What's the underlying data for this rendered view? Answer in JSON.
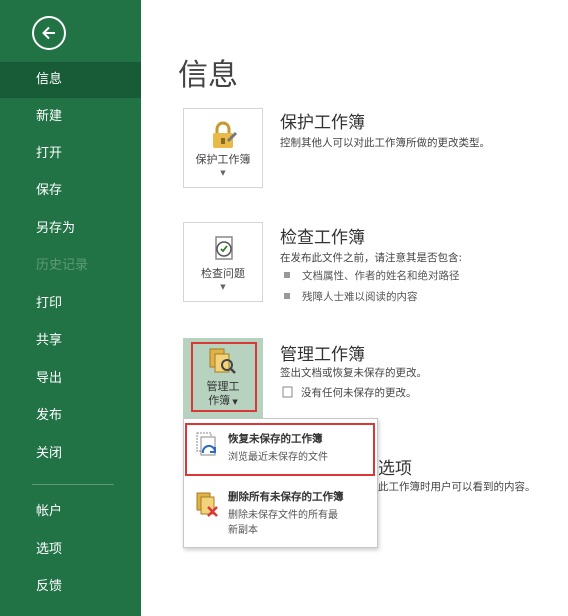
{
  "sidebar": {
    "back_icon": "back-arrow-icon",
    "items": [
      {
        "label": "信息"
      },
      {
        "label": "新建"
      },
      {
        "label": "打开"
      },
      {
        "label": "保存"
      },
      {
        "label": "另存为"
      },
      {
        "label": "历史记录"
      },
      {
        "label": "打印"
      },
      {
        "label": "共享"
      },
      {
        "label": "导出"
      },
      {
        "label": "发布"
      },
      {
        "label": "关闭"
      },
      {
        "label": "帐户"
      },
      {
        "label": "选项"
      },
      {
        "label": "反馈"
      }
    ]
  },
  "page_title": "信息",
  "protect": {
    "button_label": "保护工作簿",
    "title": "保护工作簿",
    "desc": "控制其他人可以对此工作簿所做的更改类型。"
  },
  "inspect": {
    "button_label": "检查问题",
    "title": "检查工作簿",
    "desc": "在发布此文件之前，请注意其是否包含:",
    "bullets": [
      "文档属性、作者的姓名和绝对路径",
      "残障人士难以阅读的内容"
    ]
  },
  "manage": {
    "button_label_line1": "管理工",
    "button_label_line2": "作簿",
    "title": "管理工作簿",
    "desc": "签出文档或恢复未保存的更改。",
    "status": "没有任何未保存的更改。"
  },
  "dropdown": {
    "items": [
      {
        "title": "恢复未保存的工作簿",
        "sub": "浏览最近未保存的文件"
      },
      {
        "title": "删除所有未保存的工作簿",
        "sub_line1": "删除未保存文件的所有最",
        "sub_line2": "新副本"
      }
    ]
  },
  "browser": {
    "title_partial": "选项",
    "desc_partial": "此工作簿时用户可以看到的内容。"
  },
  "colors": {
    "sidebar": "#217346",
    "sidebar_active": "#185c37",
    "highlight": "#b7d3c0",
    "annotation_red": "#d9383a"
  }
}
